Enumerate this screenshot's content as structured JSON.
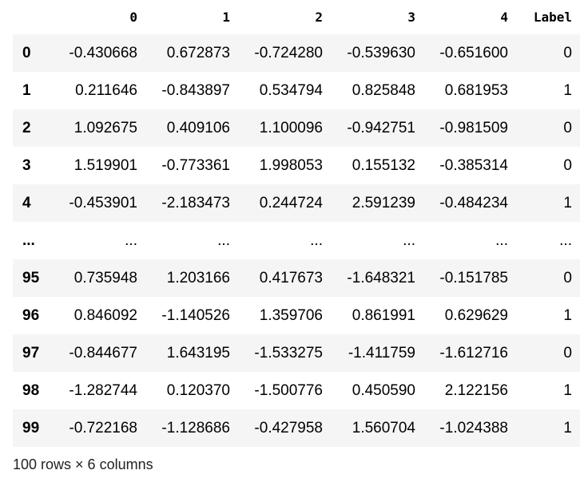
{
  "dataframe": {
    "columns": [
      "0",
      "1",
      "2",
      "3",
      "4",
      "Label"
    ],
    "rows": [
      {
        "index": "0",
        "cells": [
          "-0.430668",
          "0.672873",
          "-0.724280",
          "-0.539630",
          "-0.651600",
          "0"
        ]
      },
      {
        "index": "1",
        "cells": [
          "0.211646",
          "-0.843897",
          "0.534794",
          "0.825848",
          "0.681953",
          "1"
        ]
      },
      {
        "index": "2",
        "cells": [
          "1.092675",
          "0.409106",
          "1.100096",
          "-0.942751",
          "-0.981509",
          "0"
        ]
      },
      {
        "index": "3",
        "cells": [
          "1.519901",
          "-0.773361",
          "1.998053",
          "0.155132",
          "-0.385314",
          "0"
        ]
      },
      {
        "index": "4",
        "cells": [
          "-0.453901",
          "-2.183473",
          "0.244724",
          "2.591239",
          "-0.484234",
          "1"
        ]
      },
      {
        "index": "...",
        "cells": [
          "...",
          "...",
          "...",
          "...",
          "...",
          "..."
        ]
      },
      {
        "index": "95",
        "cells": [
          "0.735948",
          "1.203166",
          "0.417673",
          "-1.648321",
          "-0.151785",
          "0"
        ]
      },
      {
        "index": "96",
        "cells": [
          "0.846092",
          "-1.140526",
          "1.359706",
          "0.861991",
          "0.629629",
          "1"
        ]
      },
      {
        "index": "97",
        "cells": [
          "-0.844677",
          "1.643195",
          "-1.533275",
          "-1.411759",
          "-1.612716",
          "0"
        ]
      },
      {
        "index": "98",
        "cells": [
          "-1.282744",
          "0.120370",
          "-1.500776",
          "0.450590",
          "2.122156",
          "1"
        ]
      },
      {
        "index": "99",
        "cells": [
          "-0.722168",
          "-1.128686",
          "-0.427958",
          "1.560704",
          "-1.024388",
          "1"
        ]
      }
    ],
    "shape_text": "100 rows × 6 columns"
  }
}
